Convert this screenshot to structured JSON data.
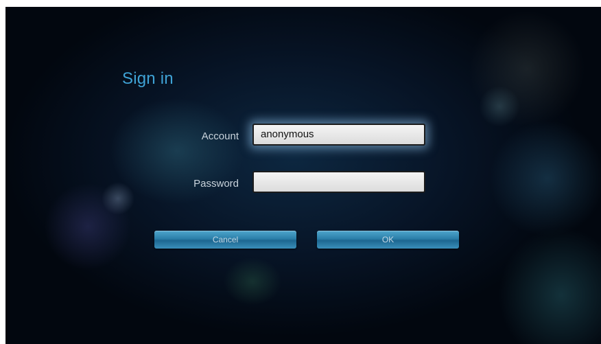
{
  "window": {
    "title": "Sign in"
  },
  "form": {
    "account_label": "Account",
    "account_value": "anonymous",
    "password_label": "Password",
    "password_value": ""
  },
  "buttons": {
    "cancel_label": "Cancel",
    "ok_label": "OK"
  },
  "colors": {
    "title": "#3fa3d6",
    "button": "#2b7fa9",
    "background": "#071426",
    "field": "#f4f4f4"
  }
}
